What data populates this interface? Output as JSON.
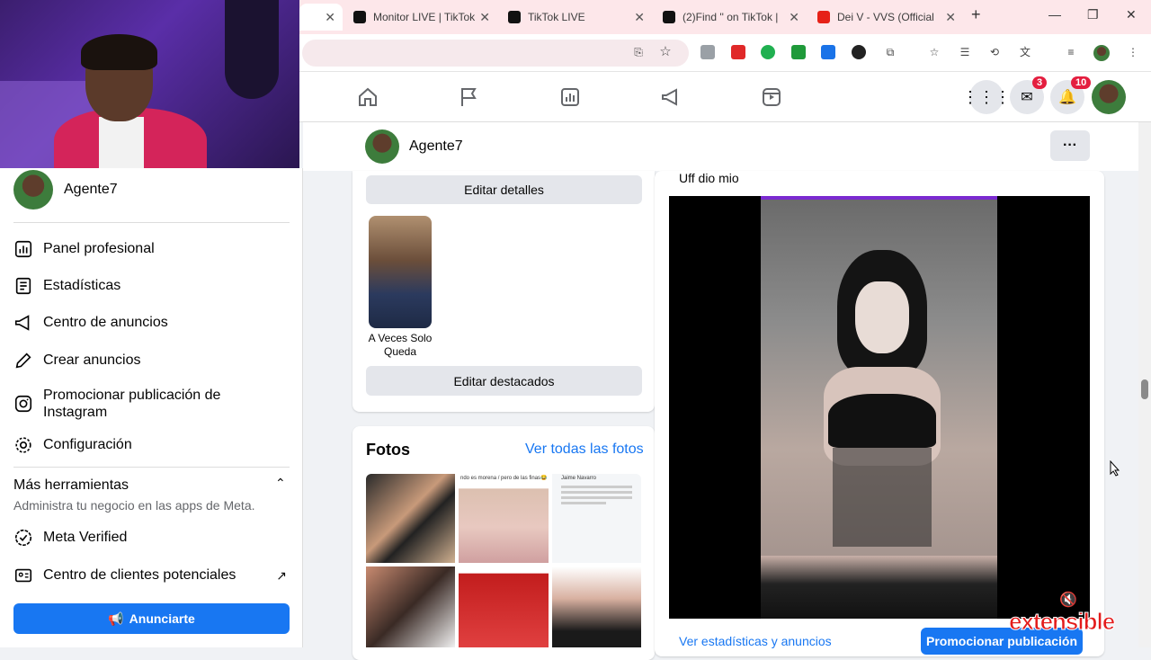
{
  "browser": {
    "tabs": [
      {
        "label": "Monitor LIVE | TikTok",
        "icon": "tiktok-icon"
      },
      {
        "label": "TikTok LIVE",
        "icon": "tiktok-icon"
      },
      {
        "label": "(2)Find '' on TikTok |",
        "icon": "tiktok-icon"
      },
      {
        "label": "Dei V - VVS (Official",
        "icon": "youtube-icon"
      }
    ],
    "new_tab": "+",
    "window": {
      "minimize": "—",
      "maximize": "❐",
      "close": "✕"
    }
  },
  "fb_nav": {
    "messenger_badge": "3",
    "notifications_badge": "10"
  },
  "sidebar": {
    "profile_name": "Agente7",
    "items": [
      {
        "label": "Panel profesional",
        "icon": "dashboard-icon"
      },
      {
        "label": "Estadísticas",
        "icon": "stats-icon"
      },
      {
        "label": "Centro de anuncios",
        "icon": "megaphone-icon"
      },
      {
        "label": "Crear anuncios",
        "icon": "pencil-icon"
      },
      {
        "label": "Promocionar publicación de Instagram",
        "icon": "instagram-icon"
      },
      {
        "label": "Configuración",
        "icon": "gear-icon"
      }
    ],
    "more_tools": {
      "title": "Más herramientas",
      "subtitle": "Administra tu negocio en las apps de Meta."
    },
    "tools": [
      {
        "label": "Meta Verified",
        "icon": "verified-icon"
      },
      {
        "label": "Centro de clientes potenciales",
        "icon": "contacts-icon"
      }
    ],
    "cta": "Anunciarte"
  },
  "profile_bar": {
    "name": "Agente7",
    "more": "···"
  },
  "left_column": {
    "edit_details": "Editar detalles",
    "highlight_label": "A Veces Solo Queda",
    "edit_highlights": "Editar destacados",
    "photos_title": "Fotos",
    "photos_link": "Ver todas las fotos",
    "photo_captions": [
      "ndo es morena / pero de las finas😂",
      "Jaime Navarro"
    ]
  },
  "post": {
    "caption": "Uff dio mio",
    "stats_link": "Ver estadísticas y anuncios",
    "promote_button": "Promocionar publicación"
  },
  "watermark": "extensible",
  "colors": {
    "fb_blue": "#1877f2",
    "badge_red": "#e41e3f",
    "tab_strip": "#fde7ea"
  }
}
